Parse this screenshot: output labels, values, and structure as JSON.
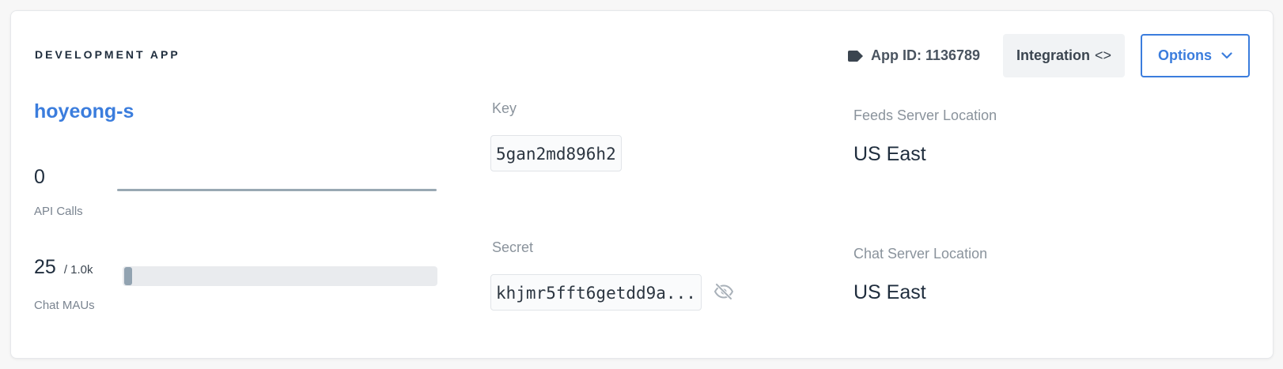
{
  "header": {
    "section_title": "DEVELOPMENT APP",
    "app_id_label": "App ID: 1136789",
    "integration_label": "Integration",
    "integration_icon": "<>",
    "options_label": "Options"
  },
  "app": {
    "name": "hoyeong-s"
  },
  "metrics": {
    "api_calls_value": "0",
    "api_calls_label": "API Calls",
    "chat_maus_value": "25",
    "chat_maus_limit": "/ 1.0k",
    "chat_maus_label": "Chat MAUs",
    "chat_maus_fraction": 0.025
  },
  "credentials": {
    "key_label": "Key",
    "key_value": "5gan2md896h2",
    "secret_label": "Secret",
    "secret_value": "khjmr5fft6getdd9a..."
  },
  "locations": {
    "feeds_label": "Feeds Server Location",
    "feeds_value": "US East",
    "chat_label": "Chat Server Location",
    "chat_value": "US East"
  },
  "colors": {
    "accent": "#3b7ddd",
    "bar_fill": "#92a3b1"
  },
  "icons": {
    "app_id": "tag-icon",
    "options": "chevron-down-icon",
    "secret": "eye-slash-icon"
  }
}
